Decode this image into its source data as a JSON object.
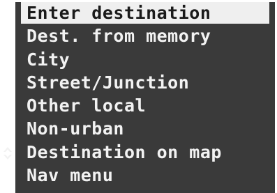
{
  "menu": {
    "items": [
      {
        "label": "Enter destination"
      },
      {
        "label": "Dest. from memory"
      },
      {
        "label": "City"
      },
      {
        "label": "Street/Junction"
      },
      {
        "label": "Other local"
      },
      {
        "label": "Non-urban"
      },
      {
        "label": "Destination on map"
      },
      {
        "label": "Nav menu"
      }
    ],
    "selected_index": 0,
    "scroll_indicator_icon": "up-down-arrows-icon"
  },
  "colors": {
    "screen_background": "#3a3a3a",
    "text": "#f2f2f2",
    "highlight_background": "#efefef",
    "highlight_text": "#1a1a1a"
  }
}
